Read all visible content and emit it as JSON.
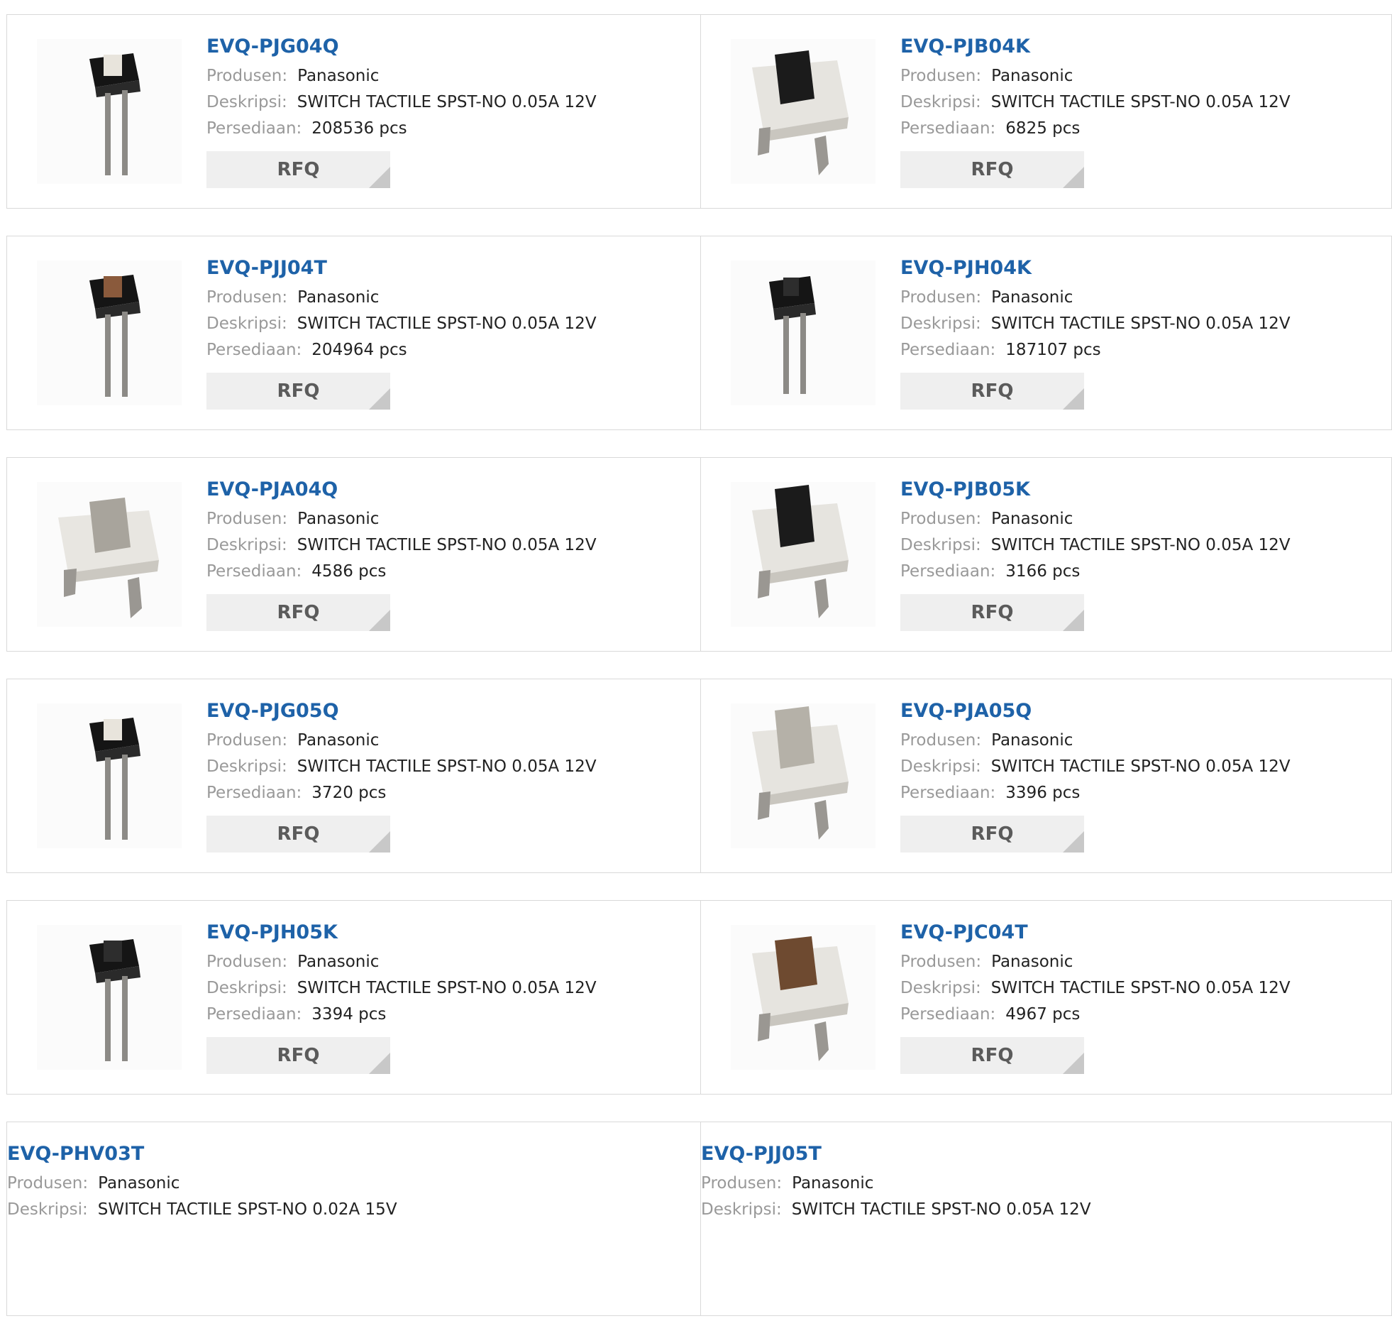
{
  "labels": {
    "manufacturer": "Produsen:",
    "description": "Deskripsi:",
    "stock": "Persediaan:",
    "rfq": "RFQ"
  },
  "products": [
    {
      "part": "EVQ-PJG04Q",
      "manufacturer": "Panasonic",
      "description": "SWITCH TACTILE SPST-NO 0.05A 12V",
      "stock": "208536 pcs",
      "image": "tactile-switch-black-through-hole-tall-icon"
    },
    {
      "part": "EVQ-PJB04K",
      "manufacturer": "Panasonic",
      "description": "SWITCH TACTILE SPST-NO 0.05A 12V",
      "stock": "6825 pcs",
      "image": "tactile-switch-white-black-actuator-icon"
    },
    {
      "part": "EVQ-PJJ04T",
      "manufacturer": "Panasonic",
      "description": "SWITCH TACTILE SPST-NO 0.05A 12V",
      "stock": "204964 pcs",
      "image": "tactile-switch-black-brown-actuator-tall-icon"
    },
    {
      "part": "EVQ-PJH04K",
      "manufacturer": "Panasonic",
      "description": "SWITCH TACTILE SPST-NO 0.05A 12V",
      "stock": "187107 pcs",
      "image": "tactile-switch-black-through-hole-tall-icon"
    },
    {
      "part": "EVQ-PJA04Q",
      "manufacturer": "Panasonic",
      "description": "SWITCH TACTILE SPST-NO 0.05A 12V",
      "stock": "4586 pcs",
      "image": "tactile-switch-white-gray-actuator-icon"
    },
    {
      "part": "EVQ-PJB05K",
      "manufacturer": "Panasonic",
      "description": "SWITCH TACTILE SPST-NO 0.05A 12V",
      "stock": "3166 pcs",
      "image": "tactile-switch-white-black-actuator-icon"
    },
    {
      "part": "EVQ-PJG05Q",
      "manufacturer": "Panasonic",
      "description": "SWITCH TACTILE SPST-NO 0.05A 12V",
      "stock": "3720 pcs",
      "image": "tactile-switch-black-through-hole-tall-icon"
    },
    {
      "part": "EVQ-PJA05Q",
      "manufacturer": "Panasonic",
      "description": "SWITCH TACTILE SPST-NO 0.05A 12V",
      "stock": "3396 pcs",
      "image": "tactile-switch-white-gray-actuator-icon"
    },
    {
      "part": "EVQ-PJH05K",
      "manufacturer": "Panasonic",
      "description": "SWITCH TACTILE SPST-NO 0.05A 12V",
      "stock": "3394 pcs",
      "image": "tactile-switch-black-through-hole-tall-icon"
    },
    {
      "part": "EVQ-PJC04T",
      "manufacturer": "Panasonic",
      "description": "SWITCH TACTILE SPST-NO 0.05A 12V",
      "stock": "4967 pcs",
      "image": "tactile-switch-white-brown-actuator-icon"
    },
    {
      "part": "EVQ-PHV03T",
      "manufacturer": "Panasonic",
      "description": "SWITCH TACTILE SPST-NO 0.02A 15V",
      "stock": "",
      "image": ""
    },
    {
      "part": "EVQ-PJJ05T",
      "manufacturer": "Panasonic",
      "description": "SWITCH TACTILE SPST-NO 0.05A 12V",
      "stock": "",
      "image": ""
    }
  ]
}
